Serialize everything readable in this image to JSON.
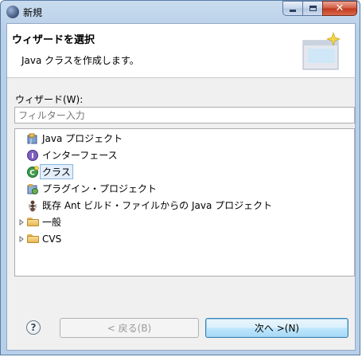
{
  "window": {
    "title": "新規"
  },
  "header": {
    "title": "ウィザードを選択",
    "description": "Java クラスを作成します。"
  },
  "wizards": {
    "label": "ウィザード(W):",
    "filter_placeholder": "フィルター入力",
    "filter_value": "",
    "items": [
      {
        "label": "Java プロジェクト",
        "icon": "java-project-icon",
        "expandable": false,
        "selected": false
      },
      {
        "label": "インターフェース",
        "icon": "interface-icon",
        "expandable": false,
        "selected": false
      },
      {
        "label": "クラス",
        "icon": "class-icon",
        "expandable": false,
        "selected": true
      },
      {
        "label": "プラグイン・プロジェクト",
        "icon": "plugin-project-icon",
        "expandable": false,
        "selected": false
      },
      {
        "label": "既存 Ant ビルド・ファイルからの Java プロジェクト",
        "icon": "ant-icon",
        "expandable": false,
        "selected": false
      },
      {
        "label": "一般",
        "icon": "folder-icon",
        "expandable": true,
        "selected": false
      },
      {
        "label": "CVS",
        "icon": "folder-icon",
        "expandable": true,
        "selected": false
      }
    ]
  },
  "buttons": {
    "help": "?",
    "back": "< 戻る(B)",
    "next": "次へ >(N)"
  },
  "colors": {
    "title_bar": "#b7cfe8",
    "close_button": "#c0371e",
    "selection_bg": "#e3eefb",
    "selection_border": "#8bb4de"
  }
}
